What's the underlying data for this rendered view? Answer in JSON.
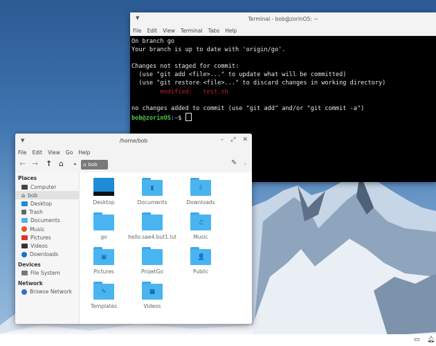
{
  "terminal": {
    "title": "Terminal - bob@zorinOS: ~",
    "menu": [
      "File",
      "Edit",
      "View",
      "Terminal",
      "Tabs",
      "Help"
    ],
    "lines": {
      "l1": "On branch go",
      "l2": "Your branch is up to date with 'origin/go'.",
      "l3": "",
      "l4": "Changes not staged for commit:",
      "l5": "  (use \"git add <file>...\" to update what will be committed)",
      "l6": "  (use \"git restore <file>...\" to discard changes in working directory)",
      "l7": "        modified:   test.sh",
      "l8": "",
      "l9": "no changes added to commit (use \"git add\" and/or \"git commit -a\")"
    },
    "prompt_user": "bob@zorinOS",
    "prompt_path": ":~",
    "prompt_symbol": "$ "
  },
  "files": {
    "title": "/home/bob",
    "menu": [
      "File",
      "Edit",
      "View",
      "Go",
      "Help"
    ],
    "path": "bob",
    "sidebar": {
      "places_heading": "Places",
      "places": [
        "Computer",
        "bob",
        "Desktop",
        "Trash",
        "Documents",
        "Music",
        "Pictures",
        "Videos",
        "Downloads"
      ],
      "devices_heading": "Devices",
      "devices": [
        "File System"
      ],
      "network_heading": "Network",
      "network": [
        "Browse Network"
      ]
    },
    "items": [
      "Desktop",
      "Documents",
      "Downloads",
      "go",
      "hello.sae4.but1.lut",
      "Music",
      "Pictures",
      "ProjetGo",
      "Public",
      "Templates",
      "Videos"
    ]
  },
  "colors": {
    "folder": "#49b4f0",
    "terminal_bg": "#000000",
    "modified": "#c01c28",
    "prompt_user": "#4ec94e"
  }
}
